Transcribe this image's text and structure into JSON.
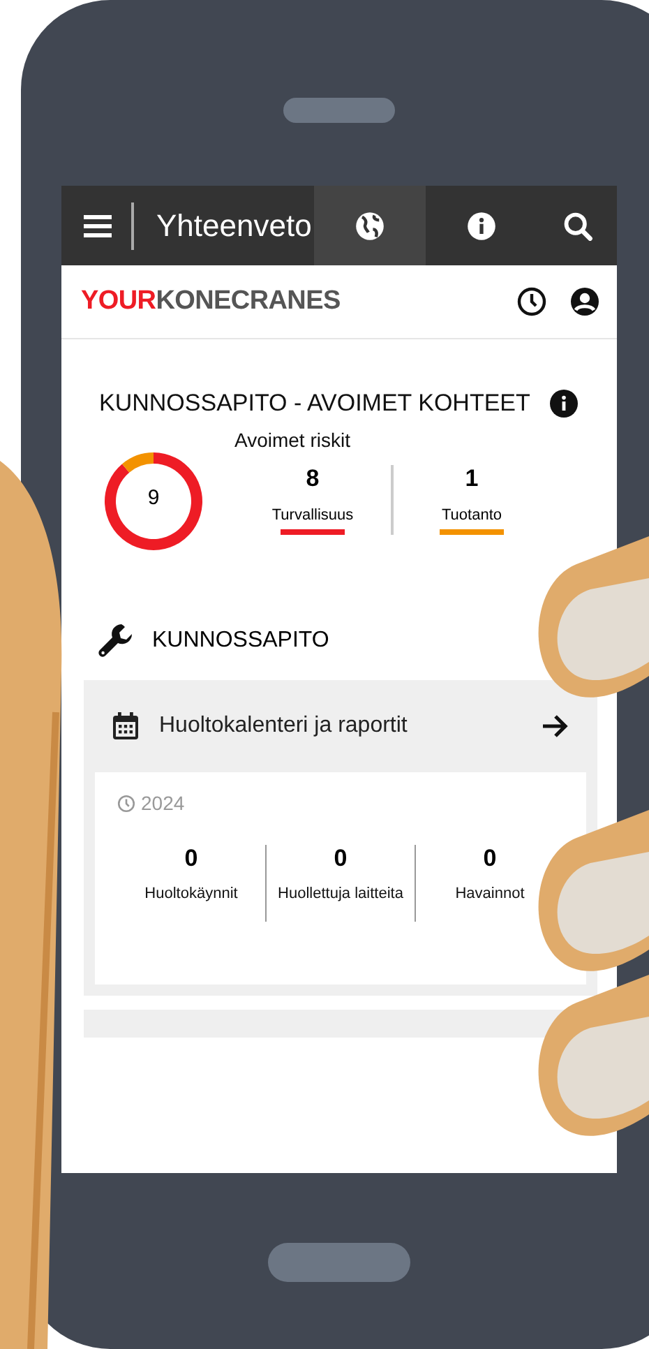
{
  "top_bar": {
    "title": "Yhteenveto",
    "actions": [
      {
        "kind": "globe",
        "selected": true
      },
      {
        "kind": "info",
        "selected": false
      },
      {
        "kind": "search",
        "selected": false
      }
    ]
  },
  "brand": {
    "logo_part_1": "YOUR",
    "logo_part_2": "KONECRANES"
  },
  "open_items": {
    "title": "KUNNOSSAPITO - AVOIMET KOHTEET",
    "total": "9",
    "risks_label": "Avoimet riskit",
    "stats": [
      {
        "value": "8",
        "label": "Turvallisuus",
        "color": "#ee1c25"
      },
      {
        "value": "1",
        "label": "Tuotanto",
        "color": "#f39200"
      }
    ]
  },
  "maintenance": {
    "title": "KUNNOSSAPITO",
    "link": "Huoltokalenteri ja raportit",
    "year": "2024",
    "stats": [
      {
        "value": "0",
        "label": "Huoltokäynnit"
      },
      {
        "value": "0",
        "label": "Huollettuja laitteita"
      },
      {
        "value": "0",
        "label": "Havainnot"
      }
    ]
  }
}
